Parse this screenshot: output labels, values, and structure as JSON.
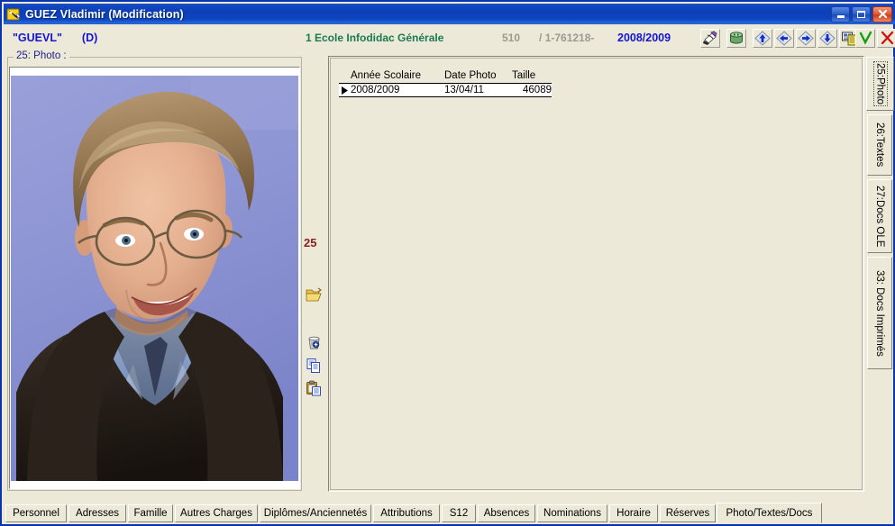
{
  "window": {
    "title": "GUEZ Vladimir (Modification)",
    "app_icon": "pencil-note-icon",
    "buttons": {
      "minimize": "minimize-button",
      "maximize": "maximize-button",
      "close": "close-button"
    }
  },
  "header": {
    "code": "\"GUEVL\"",
    "flag": "(D)",
    "school": "1 Ecole Infodidac Générale",
    "record_number": "510",
    "separator": "/",
    "record_id": "1-761218-",
    "school_year": "2008/2009",
    "toolbar": [
      {
        "name": "print-icon",
        "label": "Imprimer"
      },
      {
        "name": "database-icon",
        "label": "Base"
      },
      {
        "name": "nav-first-icon",
        "label": "Premier"
      },
      {
        "name": "nav-prev-icon",
        "label": "Précédent"
      },
      {
        "name": "nav-next-icon",
        "label": "Suivant"
      },
      {
        "name": "nav-last-icon",
        "label": "Dernier"
      },
      {
        "name": "report-icon",
        "label": "Fiche"
      },
      {
        "name": "validate-icon",
        "label": "Valider"
      },
      {
        "name": "cancel-icon",
        "label": "Annuler"
      }
    ]
  },
  "photo_panel": {
    "legend": "25: Photo :",
    "field_number": "25",
    "actions": [
      {
        "name": "open-folder-icon",
        "label": "Ouvrir"
      },
      {
        "name": "delete-trash-icon",
        "label": "Supprimer"
      },
      {
        "name": "copy-icon",
        "label": "Copier"
      },
      {
        "name": "paste-icon",
        "label": "Coller"
      }
    ],
    "image_alt": "Portrait photo of a smiling man with glasses wearing a dark sweater over a blue shirt on a purple-blue background"
  },
  "grid": {
    "columns": [
      "Année Scolaire",
      "Date Photo",
      "Taille"
    ],
    "rows": [
      {
        "marker": "▶",
        "annee_scolaire": "2008/2009",
        "date_photo": "13/04/11",
        "taille": "46089"
      }
    ]
  },
  "side_tabs": [
    {
      "label": "25:Photo",
      "active": true
    },
    {
      "label": "26:Textes",
      "active": false
    },
    {
      "label": "27:Docs OLE",
      "active": false
    },
    {
      "label": "33: Docs Imprimés",
      "active": false
    }
  ],
  "bottom_tabs": [
    {
      "label": "Personnel",
      "active": false
    },
    {
      "label": "Adresses",
      "active": false
    },
    {
      "label": "Famille",
      "active": false
    },
    {
      "label": "Autres Charges",
      "active": false
    },
    {
      "label": "Diplômes/Anciennetés",
      "active": false
    },
    {
      "label": "Attributions",
      "active": false
    },
    {
      "label": "S12",
      "active": false
    },
    {
      "label": "Absences",
      "active": false
    },
    {
      "label": "Nominations",
      "active": false
    },
    {
      "label": "Horaire",
      "active": false
    },
    {
      "label": "Réserves",
      "active": false
    },
    {
      "label": "Photo/Textes/Docs",
      "active": true
    }
  ],
  "colors": {
    "titlebar_blue": "#0b3fb8",
    "window_face": "#ece9d8",
    "accent_blue_text": "#1414d2",
    "school_green": "#1a7a50",
    "muted_gray": "#9a9a8e",
    "field_number_red": "#8a2020",
    "validate_green": "#13a013",
    "cancel_red": "#d01010",
    "photo_bg": "#8e95d4"
  }
}
